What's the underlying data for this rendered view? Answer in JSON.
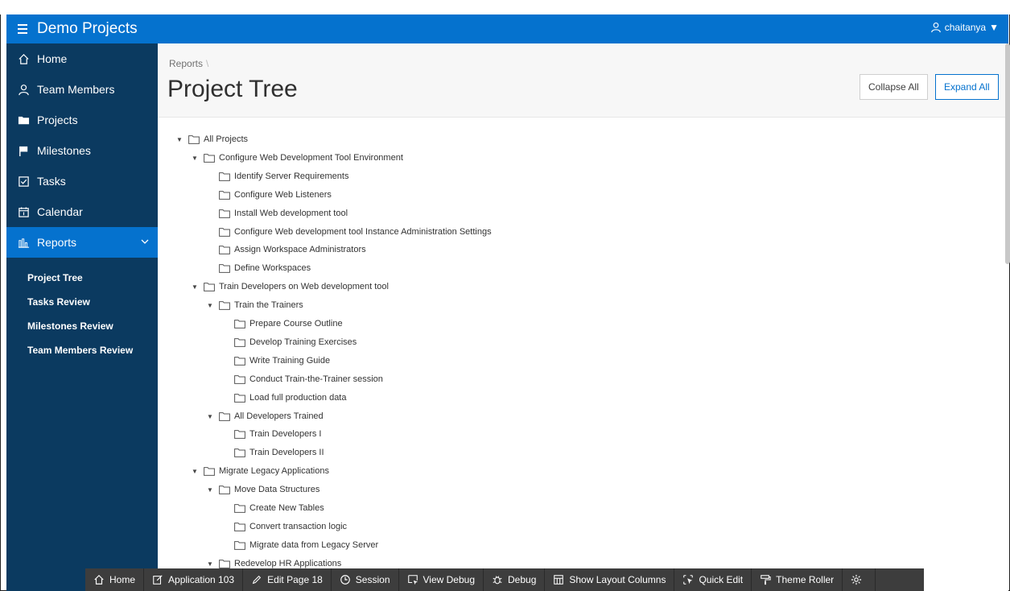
{
  "header": {
    "app_title": "Demo Projects",
    "user": "chaitanya"
  },
  "sidebar": {
    "items": [
      {
        "label": "Home",
        "icon": "home-icon"
      },
      {
        "label": "Team Members",
        "icon": "user-icon"
      },
      {
        "label": "Projects",
        "icon": "folder-icon"
      },
      {
        "label": "Milestones",
        "icon": "flag-icon"
      },
      {
        "label": "Tasks",
        "icon": "checkbox-icon"
      },
      {
        "label": "Calendar",
        "icon": "calendar-icon"
      },
      {
        "label": "Reports",
        "icon": "bar-chart-icon"
      }
    ],
    "sub_items": [
      {
        "label": "Project Tree"
      },
      {
        "label": "Tasks Review"
      },
      {
        "label": "Milestones Review"
      },
      {
        "label": "Team Members Review"
      }
    ]
  },
  "page": {
    "breadcrumb": "Reports",
    "breadcrumb_sep": "\\",
    "title": "Project Tree",
    "collapse_label": "Collapse All",
    "expand_label": "Expand All"
  },
  "tree": [
    {
      "label": "All Projects",
      "level": 0,
      "expanded": true
    },
    {
      "label": "Configure Web Development Tool Environment",
      "level": 1,
      "expanded": true
    },
    {
      "label": "Identify Server Requirements",
      "level": 2,
      "expanded": false
    },
    {
      "label": "Configure Web Listeners",
      "level": 2,
      "expanded": false
    },
    {
      "label": "Install Web development tool",
      "level": 2,
      "expanded": false
    },
    {
      "label": "Configure Web development tool Instance Administration Settings",
      "level": 2,
      "expanded": false
    },
    {
      "label": "Assign Workspace Administrators",
      "level": 2,
      "expanded": false
    },
    {
      "label": "Define Workspaces",
      "level": 2,
      "expanded": false
    },
    {
      "label": "Train Developers on Web development tool",
      "level": 1,
      "expanded": true
    },
    {
      "label": "Train the Trainers",
      "level": 2,
      "expanded": true
    },
    {
      "label": "Prepare Course Outline",
      "level": 3,
      "expanded": false
    },
    {
      "label": "Develop Training Exercises",
      "level": 3,
      "expanded": false
    },
    {
      "label": "Write Training Guide",
      "level": 3,
      "expanded": false
    },
    {
      "label": "Conduct Train-the-Trainer session",
      "level": 3,
      "expanded": false
    },
    {
      "label": "Load full production data",
      "level": 3,
      "expanded": false
    },
    {
      "label": "All Developers Trained",
      "level": 2,
      "expanded": true
    },
    {
      "label": "Train Developers I",
      "level": 3,
      "expanded": false
    },
    {
      "label": "Train Developers II",
      "level": 3,
      "expanded": false
    },
    {
      "label": "Migrate Legacy Applications",
      "level": 1,
      "expanded": true
    },
    {
      "label": "Move Data Structures",
      "level": 2,
      "expanded": true
    },
    {
      "label": "Create New Tables",
      "level": 3,
      "expanded": false
    },
    {
      "label": "Convert transaction logic",
      "level": 3,
      "expanded": false
    },
    {
      "label": "Migrate data from Legacy Server",
      "level": 3,
      "expanded": false
    },
    {
      "label": "Redevelop HR Applications",
      "level": 2,
      "expanded": true
    }
  ],
  "devbar": {
    "items": [
      {
        "label": "Home",
        "icon": "home-icon"
      },
      {
        "label": "Application 103",
        "icon": "edit-icon"
      },
      {
        "label": "Edit Page 18",
        "icon": "pencil-icon"
      },
      {
        "label": "Session",
        "icon": "clock-icon"
      },
      {
        "label": "View Debug",
        "icon": "cursor-window-icon"
      },
      {
        "label": "Debug",
        "icon": "bug-icon"
      },
      {
        "label": "Show Layout Columns",
        "icon": "grid-icon"
      },
      {
        "label": "Quick Edit",
        "icon": "select-icon"
      },
      {
        "label": "Theme Roller",
        "icon": "paint-roller-icon"
      },
      {
        "label": "",
        "icon": "gear-icon"
      }
    ]
  },
  "colors": {
    "header": "#0572ce",
    "sidebar": "#0b3a60",
    "active": "#0572ce",
    "devbar": "#3d3d3d"
  }
}
